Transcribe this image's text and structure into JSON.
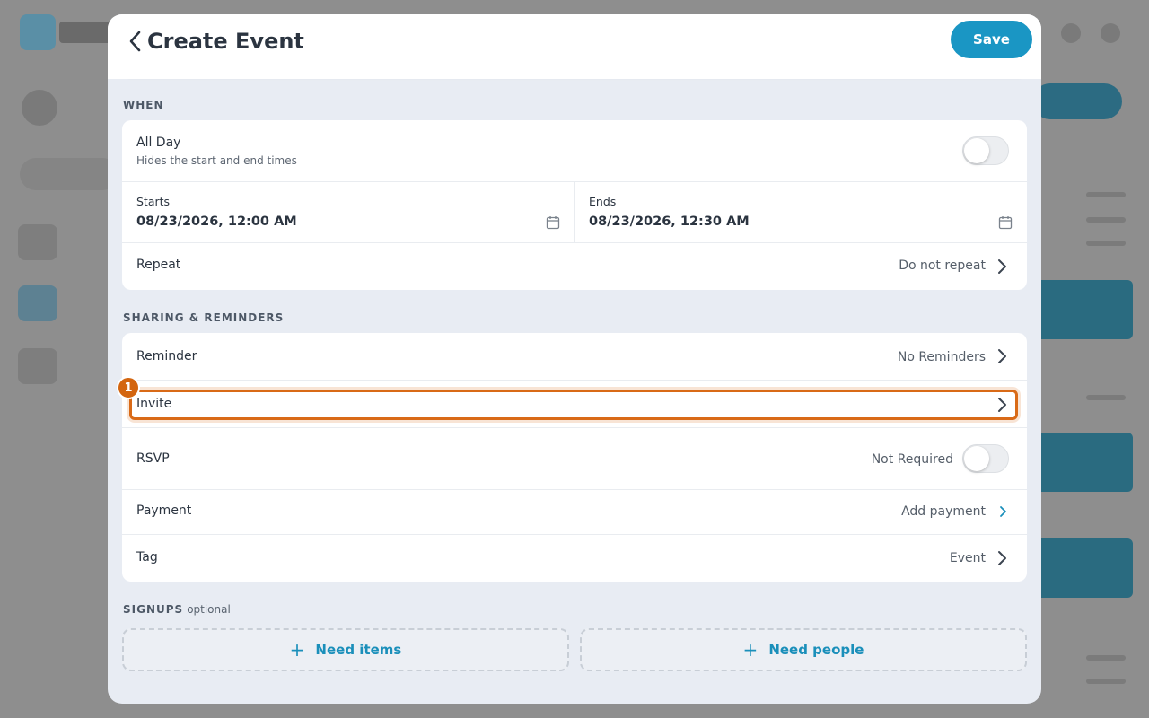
{
  "header": {
    "title": "Create Event",
    "save_label": "Save"
  },
  "when": {
    "section_label": "WHEN",
    "all_day": {
      "label": "All Day",
      "subtitle": "Hides the start and end times",
      "on": false
    },
    "starts": {
      "label": "Starts",
      "value": "08/23/2026, 12:00 AM"
    },
    "ends": {
      "label": "Ends",
      "value": "08/23/2026, 12:30 AM"
    },
    "repeat": {
      "label": "Repeat",
      "value": "Do not repeat"
    }
  },
  "sharing": {
    "section_label": "SHARING & REMINDERS",
    "reminder": {
      "label": "Reminder",
      "value": "No Reminders"
    },
    "invite": {
      "label": "Invite",
      "badge": "1"
    },
    "rsvp": {
      "label": "RSVP",
      "value": "Not Required",
      "on": false
    },
    "payment": {
      "label": "Payment",
      "value": "Add payment"
    },
    "tag": {
      "label": "Tag",
      "value": "Event"
    }
  },
  "signups": {
    "section_label": "SIGNUPS",
    "optional_label": "optional",
    "need_items": "Need items",
    "need_people": "Need people"
  },
  "colors": {
    "accent": "#1a96c4",
    "highlight": "#d96a17"
  },
  "icons": {
    "back": "chevron-left-icon",
    "calendar": "calendar-icon",
    "chevron": "chevron-right-icon",
    "plus": "plus-icon"
  }
}
